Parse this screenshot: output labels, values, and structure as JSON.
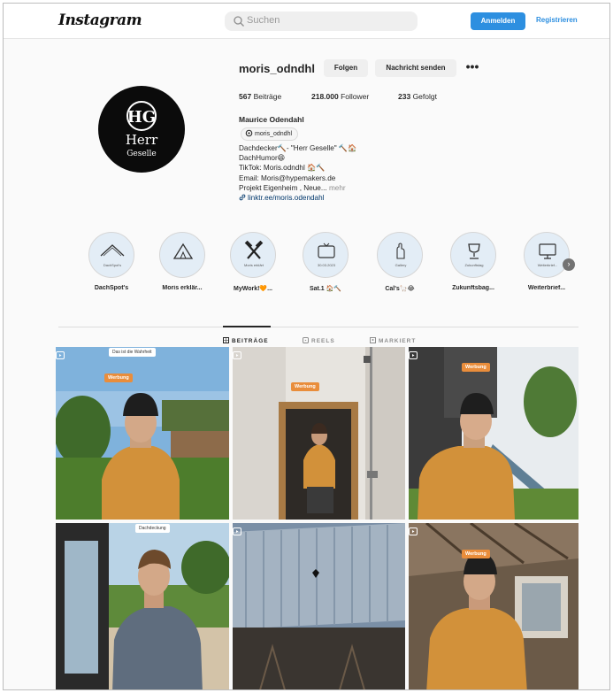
{
  "topbar": {
    "logo": "Instagram",
    "search_placeholder": "Suchen",
    "login_label": "Anmelden",
    "register_label": "Registrieren"
  },
  "profile": {
    "username": "moris_odndhl",
    "follow_label": "Folgen",
    "message_label": "Nachricht senden",
    "more_label": "•••",
    "stats": [
      {
        "value": "567",
        "label": "Beiträge"
      },
      {
        "value": "218.000",
        "label": "Follower"
      },
      {
        "value": "233",
        "label": "Gefolgt"
      }
    ],
    "full_name": "Maurice Odendahl",
    "threads_handle": "moris_odndhl",
    "avatar_text": {
      "monogram": "HG",
      "word1": "Herr",
      "word2": "Geselle"
    },
    "bio": {
      "line1": "Dachdecker🔨- \"Herr Geselle\" 🔨🏠",
      "line2": "DachHumor😄",
      "line3": "TikTok: Moris.odndhl 🏠🔨",
      "line4": "Email: Moris@hypemakers.de",
      "line5": "Projekt Eigenheim , Neue... ",
      "more": "mehr",
      "link": "linktr.ee/moris.odendahl"
    }
  },
  "highlights": [
    {
      "label": "DachSpot's",
      "caption": "DachSpot's",
      "icon": "roof-icon"
    },
    {
      "label": "Moris erklär...",
      "caption": "",
      "icon": "tent-icon"
    },
    {
      "label": "MyWork!🧡...",
      "caption": "Moris erklärt",
      "icon": "hammer-icon"
    },
    {
      "label": "Sat.1 🏠🔨",
      "caption": "30.03.2023",
      "icon": "tv-icon"
    },
    {
      "label": "Cal's🦙😂",
      "caption": "Gallery",
      "icon": "hand-icon"
    },
    {
      "label": "Zukunftsbag...",
      "caption": "Zukunftstag",
      "icon": "trophy-icon"
    },
    {
      "label": "Weiterbrief...",
      "caption": "Weiterbrief...",
      "icon": "computer-icon"
    }
  ],
  "tabs": [
    {
      "label": "BEITRÄGE",
      "icon": "grid-icon",
      "active": true
    },
    {
      "label": "REELS",
      "icon": "reels-icon",
      "active": false
    },
    {
      "label": "MARKIERT",
      "icon": "tagged-icon",
      "active": false
    }
  ],
  "grid": [
    {
      "tag": "Werbung",
      "caption": "Das ist die Wahrheit",
      "reel": true
    },
    {
      "tag": "Werbung",
      "caption": "",
      "reel": true
    },
    {
      "tag": "Werbung",
      "caption": "",
      "reel": true
    },
    {
      "tag": "",
      "caption": "Dachdeckung",
      "reel": false
    },
    {
      "tag": "",
      "caption": "",
      "reel": true
    },
    {
      "tag": "Werbung",
      "caption": "",
      "reel": true
    }
  ],
  "colors": {
    "accent": "#2d8fe0",
    "tag": "#e98d3b",
    "sweater": "#d2913a"
  }
}
